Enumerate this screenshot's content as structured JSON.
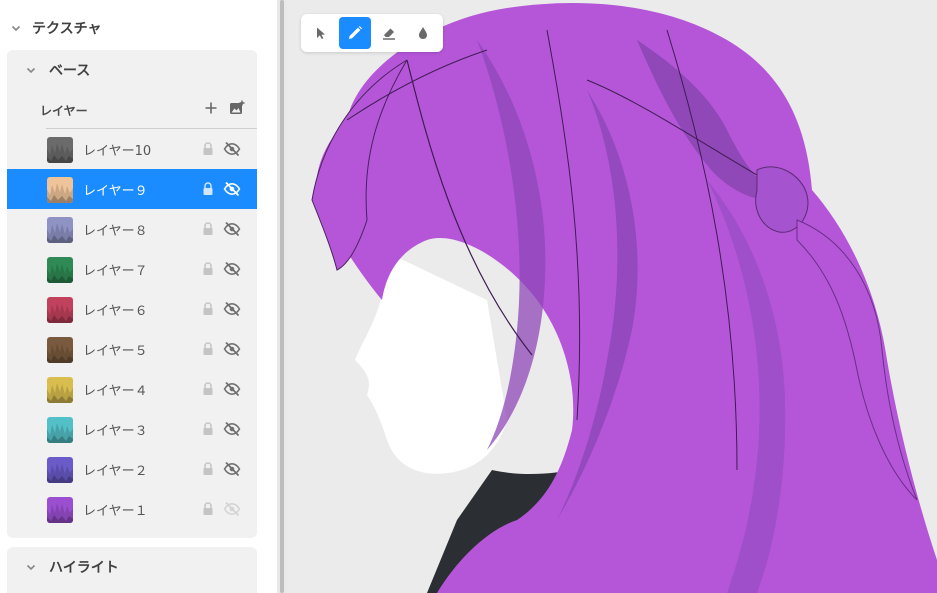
{
  "panel": {
    "section_title": "テクスチャ",
    "groups": {
      "base": {
        "title": "ベース"
      },
      "highlight": {
        "title": "ハイライト"
      }
    },
    "layer_header": {
      "label": "レイヤー",
      "add_icon": "plus-icon",
      "add_image_icon": "add-image-icon"
    },
    "layers": [
      {
        "name": "レイヤー10",
        "color": "#6b6b6b",
        "selected": false,
        "visible": false
      },
      {
        "name": "レイヤー９",
        "color": "#f0c49a",
        "selected": true,
        "visible": false
      },
      {
        "name": "レイヤー８",
        "color": "#8f93c4",
        "selected": false,
        "visible": false
      },
      {
        "name": "レイヤー７",
        "color": "#2f8a55",
        "selected": false,
        "visible": false
      },
      {
        "name": "レイヤー６",
        "color": "#c2415c",
        "selected": false,
        "visible": false
      },
      {
        "name": "レイヤー５",
        "color": "#7a5a3e",
        "selected": false,
        "visible": false
      },
      {
        "name": "レイヤー４",
        "color": "#d9bd4f",
        "selected": false,
        "visible": false
      },
      {
        "name": "レイヤー３",
        "color": "#53bfc6",
        "selected": false,
        "visible": false
      },
      {
        "name": "レイヤー２",
        "color": "#6a5bc8",
        "selected": false,
        "visible": false
      },
      {
        "name": "レイヤー１",
        "color": "#9a4fd0",
        "selected": false,
        "visible": true
      }
    ]
  },
  "toolbar": {
    "tools": [
      {
        "name": "select",
        "icon": "cursor-icon",
        "active": false
      },
      {
        "name": "pen",
        "icon": "pen-icon",
        "active": true
      },
      {
        "name": "eraser",
        "icon": "eraser-icon",
        "active": false
      },
      {
        "name": "fill",
        "icon": "drop-icon",
        "active": false
      }
    ]
  },
  "colors": {
    "accent": "#1a8cff",
    "hair": "#b556d9",
    "hair_shadow": "#8f47b8"
  }
}
